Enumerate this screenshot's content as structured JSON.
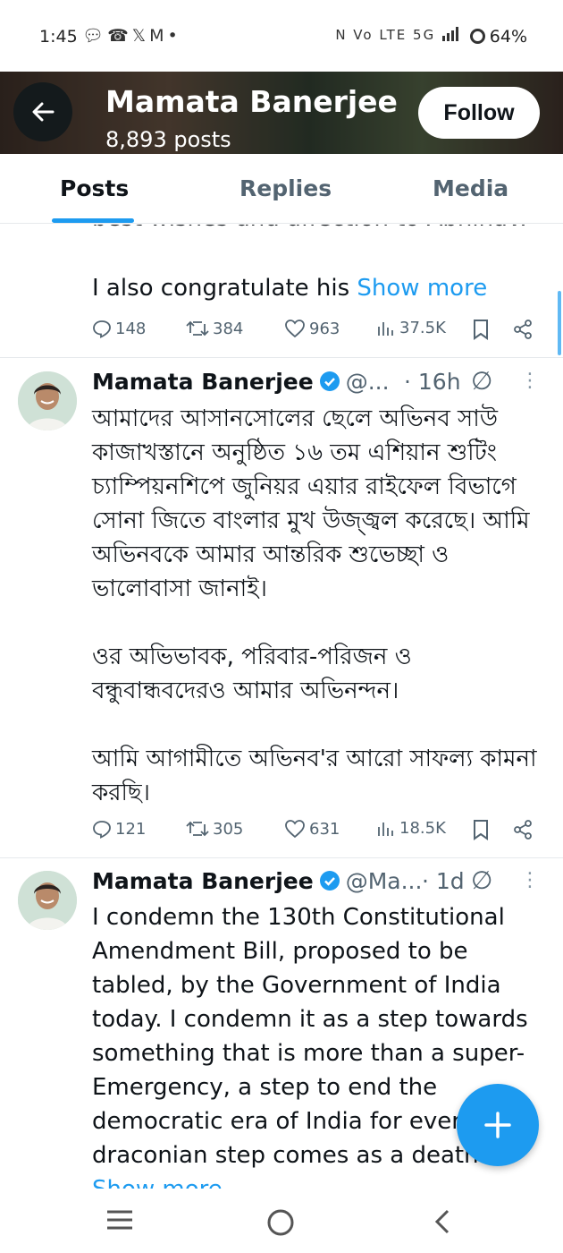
{
  "status_bar": {
    "time": "1:45",
    "left_icons": [
      "chat-bubble-icon",
      "whatsapp-icon",
      "x-logo-icon",
      "gmail-icon",
      "dot-icon"
    ],
    "right_icons_text": "N Vo LTE 5G",
    "battery": "64%"
  },
  "header": {
    "name": "Mamata Banerjee",
    "posts": "8,893 posts",
    "follow_label": "Follow"
  },
  "tabs": [
    {
      "label": "Posts",
      "active": true
    },
    {
      "label": "Replies",
      "active": false
    },
    {
      "label": "Media",
      "active": false
    }
  ],
  "tweets": [
    {
      "cut_text": "best wishes and affection to Abhinav.",
      "text": "I also congratulate his",
      "show_more": "Show more",
      "replies": "148",
      "reposts": "384",
      "likes": "963",
      "views": "37.5K"
    },
    {
      "author": "Mamata Banerjee",
      "handle": "@...",
      "time": "· 16h",
      "paragraphs": [
        "আমাদের আসানসোলের ছেলে অভিনব সাউ কাজাখস্তানে অনুষ্ঠিত ১৬ তম এশিয়ান শুটিং চ্যাম্পিয়নশিপে জুনিয়র এয়ার রাইফেল বিভাগে সোনা জিতে বাংলার মুখ উজ্জ্বল করেছে। আমি অভিনবকে আমার আন্তরিক শুভেচ্ছা ও ভালোবাসা জানাই।",
        "ওর অভিভাবক, পরিবার-পরিজন ও বন্ধুবান্ধবদেরও আমার অভিনন্দন।",
        "আমি আগামীতে অভিনব'র আরো সাফল্য কামনা করছি।"
      ],
      "replies": "121",
      "reposts": "305",
      "likes": "631",
      "views": "18.5K"
    },
    {
      "author": "Mamata Banerjee",
      "handle": "@Ma...",
      "time": "· 1d",
      "text": "I condemn the 130th Constitutional Amendment Bill, proposed to be tabled,  by the Government of India today. I condemn it as a step towards something that is more than a super-Emergency, a step to end the democratic era of India for ever. This draconian step comes as a death",
      "show_more": "Show more"
    }
  ],
  "colors": {
    "accent": "#1d9bf0",
    "text": "#0f1419",
    "muted": "#536471"
  }
}
